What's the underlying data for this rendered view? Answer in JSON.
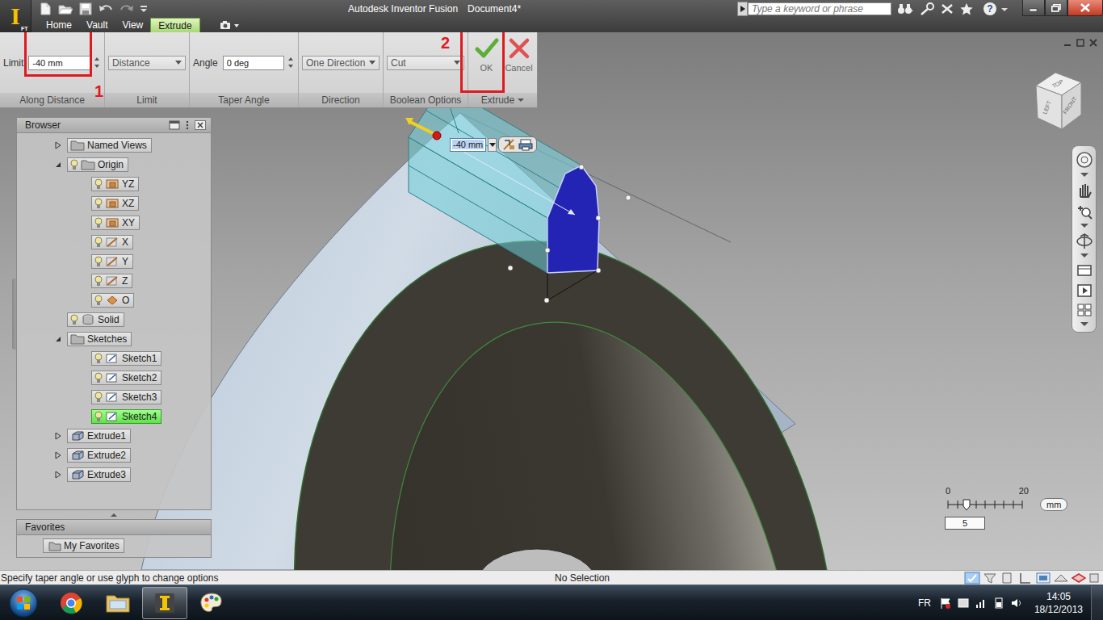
{
  "app": {
    "logo": "I",
    "badge": "FT"
  },
  "window": {
    "title": "Autodesk Inventor Fusion",
    "document": "Document4*"
  },
  "search": {
    "placeholder": "Type a keyword or phrase"
  },
  "infocenter": {
    "help": "?"
  },
  "tabs": [
    {
      "label": "Home",
      "selected": false
    },
    {
      "label": "Vault",
      "selected": false
    },
    {
      "label": "View",
      "selected": false
    },
    {
      "label": "Extrude",
      "selected": true
    }
  ],
  "ribbon": {
    "groups": [
      {
        "title": "Along Distance",
        "kind": "spin",
        "label": "Limit",
        "value": "-40 mm",
        "annotation": "1"
      },
      {
        "title": "Limit",
        "kind": "dropdown",
        "value": "Distance"
      },
      {
        "title": "Taper Angle",
        "kind": "spin",
        "label": "Angle",
        "value": "0 deg"
      },
      {
        "title": "Direction",
        "kind": "dropdown",
        "value": "One Direction"
      },
      {
        "title": "Boolean Options",
        "kind": "dropdown",
        "value": "Cut"
      },
      {
        "title": "Extrude",
        "kind": "buttons",
        "menu": true,
        "annotation": "2",
        "buttons": [
          {
            "label": "OK",
            "kind": "ok"
          },
          {
            "label": "Cancel",
            "kind": "cancel"
          }
        ]
      }
    ]
  },
  "glyph_field": {
    "value": "-40 mm"
  },
  "viewcube": {
    "faces": [
      "TOP",
      "LEFT",
      "FRONT"
    ]
  },
  "browser": {
    "title": "Browser",
    "items": [
      {
        "label": "Named Views",
        "depth": 0,
        "expandable": true,
        "expanded": false,
        "bulb": false,
        "kind": "folder",
        "highlighted": false
      },
      {
        "label": "Origin",
        "depth": 0,
        "expandable": true,
        "expanded": true,
        "bulb": true,
        "kind": "folder",
        "highlighted": false
      },
      {
        "label": "YZ",
        "depth": 1,
        "expandable": false,
        "expanded": false,
        "bulb": true,
        "kind": "plane",
        "highlighted": false
      },
      {
        "label": "XZ",
        "depth": 1,
        "expandable": false,
        "expanded": false,
        "bulb": true,
        "kind": "plane",
        "highlighted": false
      },
      {
        "label": "XY",
        "depth": 1,
        "expandable": false,
        "expanded": false,
        "bulb": true,
        "kind": "plane",
        "highlighted": false
      },
      {
        "label": "X",
        "depth": 1,
        "expandable": false,
        "expanded": false,
        "bulb": true,
        "kind": "axis",
        "highlighted": false
      },
      {
        "label": "Y",
        "depth": 1,
        "expandable": false,
        "expanded": false,
        "bulb": true,
        "kind": "axis",
        "highlighted": false
      },
      {
        "label": "Z",
        "depth": 1,
        "expandable": false,
        "expanded": false,
        "bulb": true,
        "kind": "axis",
        "highlighted": false
      },
      {
        "label": "O",
        "depth": 1,
        "expandable": false,
        "expanded": false,
        "bulb": true,
        "kind": "point",
        "highlighted": false
      },
      {
        "label": "Solid",
        "depth": 0,
        "expandable": false,
        "expanded": false,
        "bulb": true,
        "kind": "solid",
        "highlighted": false
      },
      {
        "label": "Sketches",
        "depth": 0,
        "expandable": true,
        "expanded": true,
        "bulb": false,
        "kind": "folder",
        "highlighted": false
      },
      {
        "label": "Sketch1",
        "depth": 1,
        "expandable": false,
        "expanded": false,
        "bulb": true,
        "kind": "sketch",
        "highlighted": false
      },
      {
        "label": "Sketch2",
        "depth": 1,
        "expandable": false,
        "expanded": false,
        "bulb": true,
        "kind": "sketch",
        "highlighted": false
      },
      {
        "label": "Sketch3",
        "depth": 1,
        "expandable": false,
        "expanded": false,
        "bulb": true,
        "kind": "sketch",
        "highlighted": false
      },
      {
        "label": "Sketch4",
        "depth": 1,
        "expandable": false,
        "expanded": false,
        "bulb": true,
        "kind": "sketch",
        "highlighted": true
      },
      {
        "label": "Extrude1",
        "depth": 0,
        "expandable": true,
        "expanded": false,
        "bulb": false,
        "kind": "extrude",
        "highlighted": false
      },
      {
        "label": "Extrude2",
        "depth": 0,
        "expandable": true,
        "expanded": false,
        "bulb": false,
        "kind": "extrude",
        "highlighted": false
      },
      {
        "label": "Extrude3",
        "depth": 0,
        "expandable": true,
        "expanded": false,
        "bulb": false,
        "kind": "extrude",
        "highlighted": false
      }
    ]
  },
  "favorites": {
    "title": "Favorites",
    "items": [
      "My Favorites"
    ]
  },
  "scale": {
    "min": "0",
    "max": "20",
    "unit": "mm",
    "value": "5",
    "level": 0.25
  },
  "status_bar": {
    "prompt": "Specify taper angle or use glyph to change options",
    "selection": "No Selection"
  },
  "taskbar": {
    "apps": [
      {
        "kind": "chrome",
        "active": false
      },
      {
        "kind": "explorer",
        "active": false
      },
      {
        "kind": "inventor",
        "active": true
      },
      {
        "kind": "paint",
        "active": false
      }
    ],
    "language": "FR",
    "time": "14:05",
    "date": "18/12/2013"
  }
}
